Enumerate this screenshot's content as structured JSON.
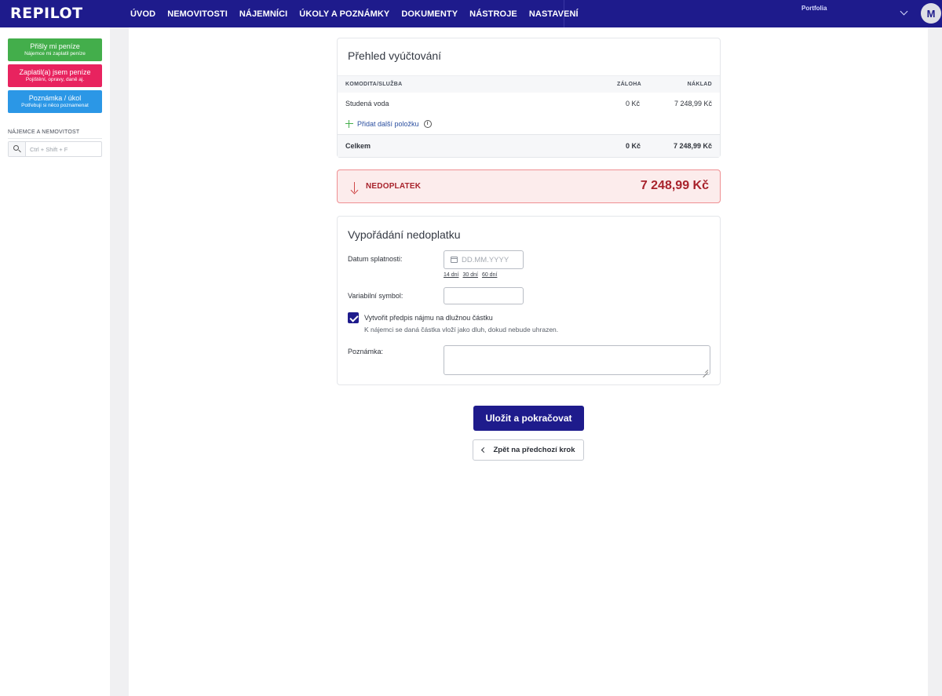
{
  "app": {
    "logo": "REPILOT"
  },
  "nav": {
    "items": [
      "ÚVOD",
      "NEMOVITOSTI",
      "NÁJEMNÍCI",
      "ÚKOLY A POZNÁMKY",
      "DOKUMENTY",
      "NÁSTROJE",
      "NASTAVENÍ"
    ],
    "portfolio_label": "Portfolia",
    "avatar_initial": "M"
  },
  "sidebar": {
    "actions": [
      {
        "title": "Přišly mi peníze",
        "subtitle": "Nájemce mi zaplatil peníze",
        "color": "#43ae4b"
      },
      {
        "title": "Zaplatil(a) jsem peníze",
        "subtitle": "Pojištění, opravy, daně aj.",
        "color": "#e8235f"
      },
      {
        "title": "Poznámka / úkol",
        "subtitle": "Potřebuji si něco poznamenat",
        "color": "#2b97e6"
      }
    ],
    "section_label": "NÁJEMCE A NEMOVITOST",
    "search_placeholder": "Ctrl + Shift + F"
  },
  "overview": {
    "title": "Přehled vyúčtování",
    "columns": [
      "KOMODITA/SLUŽBA",
      "ZÁLOHA",
      "NÁKLAD"
    ],
    "rows": [
      {
        "service": "Studená voda",
        "deposit": "0 Kč",
        "cost": "7 248,99 Kč"
      }
    ],
    "add_item_label": "Přidat další položku",
    "total": {
      "label": "Celkem",
      "deposit": "0 Kč",
      "cost": "7 248,99 Kč"
    }
  },
  "banner": {
    "label": "NEDOPLATEK",
    "amount": "7 248,99 Kč",
    "accent_color": "#a8232c"
  },
  "settlement": {
    "title": "Vypořádání nedoplatku",
    "due_date_label": "Datum splatnosti:",
    "due_date_placeholder": "DD.MM.YYYY",
    "due_date_value": "",
    "quick_options": [
      "14 dní",
      "30 dní",
      "60 dní"
    ],
    "variable_symbol_label": "Variabilní symbol:",
    "variable_symbol_value": "",
    "checkbox_checked": true,
    "checkbox_label": "Vytvořit předpis nájmu na dlužnou částku",
    "checkbox_help": "K nájemci se daná částka vloží jako dluh, dokud nebude uhrazen.",
    "note_label": "Poznámka:",
    "note_value": ""
  },
  "actions": {
    "save_label": "Uložit a pokračovat",
    "back_label": "Zpět na předchozí krok"
  },
  "colors": {
    "brand": "#1e1b8c",
    "success": "#43ae4b",
    "danger": "#e8235f",
    "info": "#2b97e6"
  }
}
